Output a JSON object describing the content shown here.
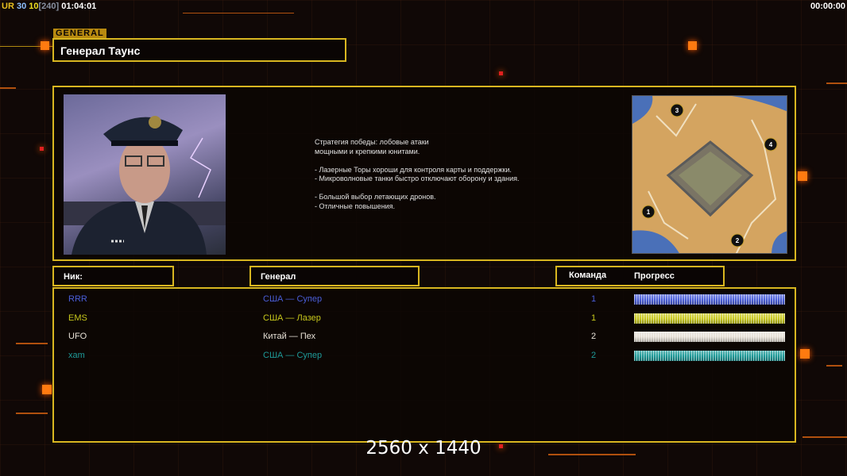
{
  "hud": {
    "ur": "UR",
    "v1": "30",
    "v2": "10",
    "v3": "[240]",
    "time": "01:04:01",
    "timer_right": "00:00:00"
  },
  "general": {
    "tag": "GENERAL",
    "name": "Генерал Таунс"
  },
  "description": [
    "Стратегия победы: лобовые атаки",
    "мощными и крепкими юнитами.",
    "",
    "- Лазерные Торы хороши для контроля карты и поддержки.",
    "- Микроволновые танки быстро отключают оборону и здания.",
    "",
    "- Большой выбор летающих дронов.",
    "- Отличные повышения."
  ],
  "map": {
    "starts": [
      "1",
      "2",
      "3",
      "4"
    ]
  },
  "table": {
    "headers": {
      "nick": "Ник:",
      "general": "Генерал",
      "team": "Команда",
      "progress": "Прогресс"
    },
    "rows": [
      {
        "nick": "RRR",
        "general": "США — Супер",
        "team": "1",
        "progress": 1.0,
        "color": "#4a5ed8"
      },
      {
        "nick": "EMS",
        "general": "США — Лазер",
        "team": "1",
        "progress": 1.0,
        "color": "#c8c81c"
      },
      {
        "nick": "UFO",
        "general": "Китай — Пех",
        "team": "2",
        "progress": 1.0,
        "color": "#e6e0d6"
      },
      {
        "nick": "xam",
        "general": "США — Супер",
        "team": "2",
        "progress": 1.0,
        "color": "#1e9a98"
      }
    ]
  },
  "resolution": "2560 x 1440"
}
